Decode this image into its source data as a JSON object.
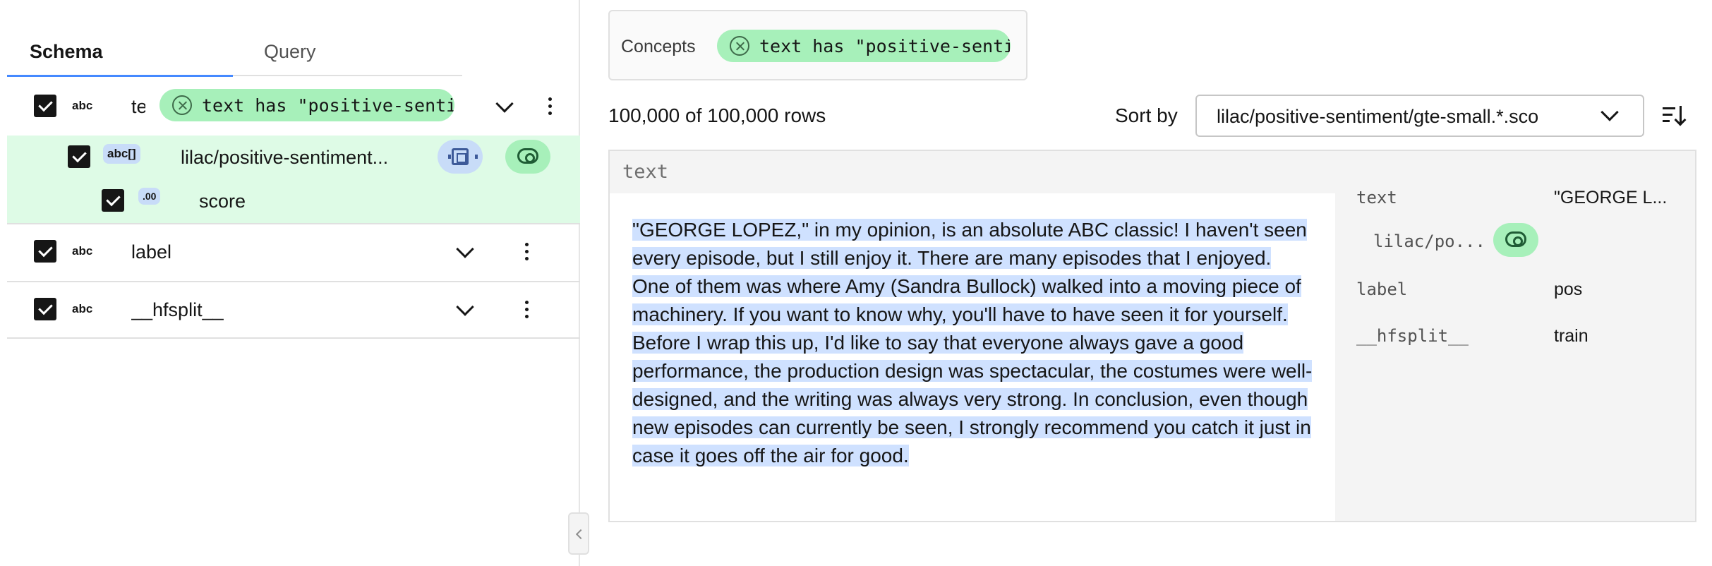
{
  "schema_panel": {
    "tabs": [
      {
        "label": "Schema",
        "active": true
      },
      {
        "label": "Query",
        "active": false
      }
    ],
    "fields": [
      {
        "dtype": "abc",
        "name": "te",
        "concept_pill": "text has \"positive-sentime...",
        "checked": true,
        "children": [
          {
            "dtype": "abc[]",
            "name": "lilac/positive-sentiment...",
            "checked": true,
            "children": [
              {
                "dtype": ".00",
                "name": "score",
                "checked": true
              }
            ]
          }
        ]
      },
      {
        "dtype": "abc",
        "name": "label",
        "checked": true
      },
      {
        "dtype": "abc",
        "name": "__hfsplit__",
        "checked": true
      }
    ]
  },
  "concepts": {
    "label": "Concepts",
    "pill": "text has \"positive-sentime..."
  },
  "results": {
    "row_count": "100,000 of 100,000 rows",
    "sort_by_label": "Sort by",
    "sort_by_value": "lilac/positive-sentiment/gte-small.*.sco"
  },
  "row": {
    "header": "text",
    "text_plain": "\"GEORGE LOPEZ,\" in my opinion, is an absolute ABC classic! I haven't seen every episode, but I still enjoy it. There are many episodes that I enjoyed. One of them was where Amy (Sandra Bullock) walked into a moving piece of machinery. If you want to know why, you'll have to have seen it for yourself. Before I wrap this up, I'd like to say ",
    "text_highlighted": "that everyone always gave a good performance, the production design was spectacular, the costumes were well-designed, and the writing was always very strong. In conclusion, even though new episodes can currently be seen, I strongly recommend you catch it just in case it goes off the air for good.",
    "metadata": [
      {
        "key": "text",
        "value": "\"GEORGE L..."
      },
      {
        "key": "lilac/po...",
        "value": ""
      },
      {
        "key": "label",
        "value": "pos"
      },
      {
        "key": "__hfsplit__",
        "value": "train"
      }
    ]
  },
  "colors": {
    "accent_blue": "#4589ff",
    "concept_green": "#a7f0ba",
    "row_green": "#defbe6",
    "highlight_blue": "#cfe1ff"
  },
  "icons": [
    "close-circle-icon",
    "chevron-down-icon",
    "overflow-menu-icon",
    "cpu-icon",
    "eye-icon",
    "sort-descending-icon",
    "collapse-panel-icon"
  ]
}
